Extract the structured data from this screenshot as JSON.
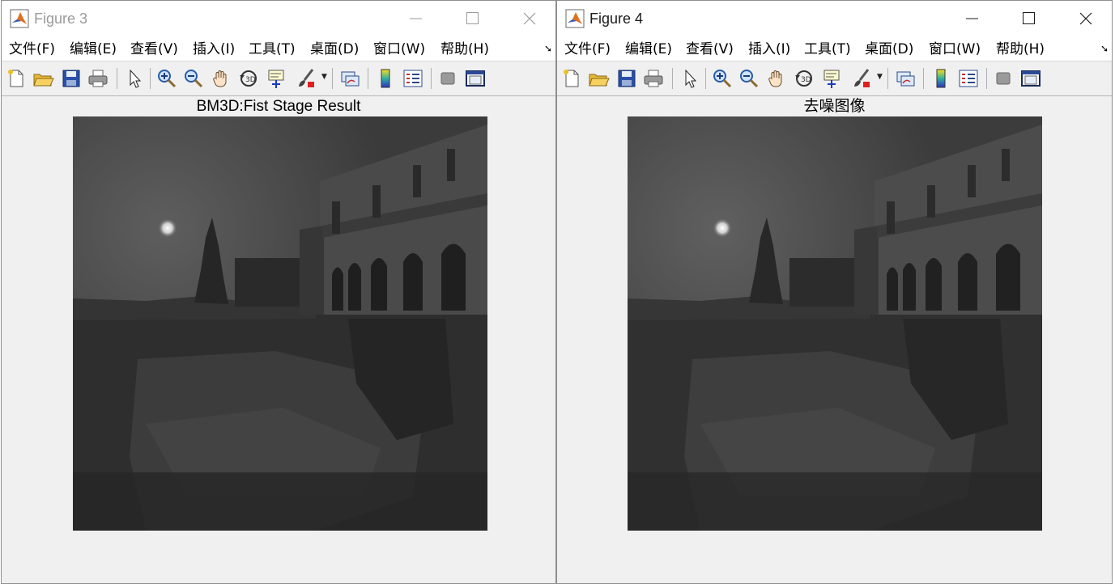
{
  "windows": [
    {
      "title": "Figure 3",
      "axes_title": "BM3D:Fist Stage Result",
      "active": false
    },
    {
      "title": "Figure 4",
      "axes_title": "去噪图像",
      "active": true
    }
  ],
  "menu": {
    "file": "文件(F)",
    "edit": "编辑(E)",
    "view": "查看(V)",
    "insert": "插入(I)",
    "tools": "工具(T)",
    "desktop": "桌面(D)",
    "window": "窗口(W)",
    "help": "帮助(H)"
  },
  "toolbar_icons": [
    "new-figure-icon",
    "open-file-icon",
    "save-icon",
    "print-icon",
    "select-arrow-icon",
    "zoom-in-icon",
    "zoom-out-icon",
    "pan-hand-icon",
    "rotate-3d-icon",
    "data-cursor-icon",
    "brush-icon",
    "link-plot-icon",
    "colorbar-icon",
    "legend-icon",
    "hide-plot-tools-icon",
    "show-plot-tools-icon"
  ],
  "colors": {
    "window_bg": "#f0f0f0",
    "title_inactive": "#9a9a9a",
    "title_active": "#1a1a1a"
  }
}
